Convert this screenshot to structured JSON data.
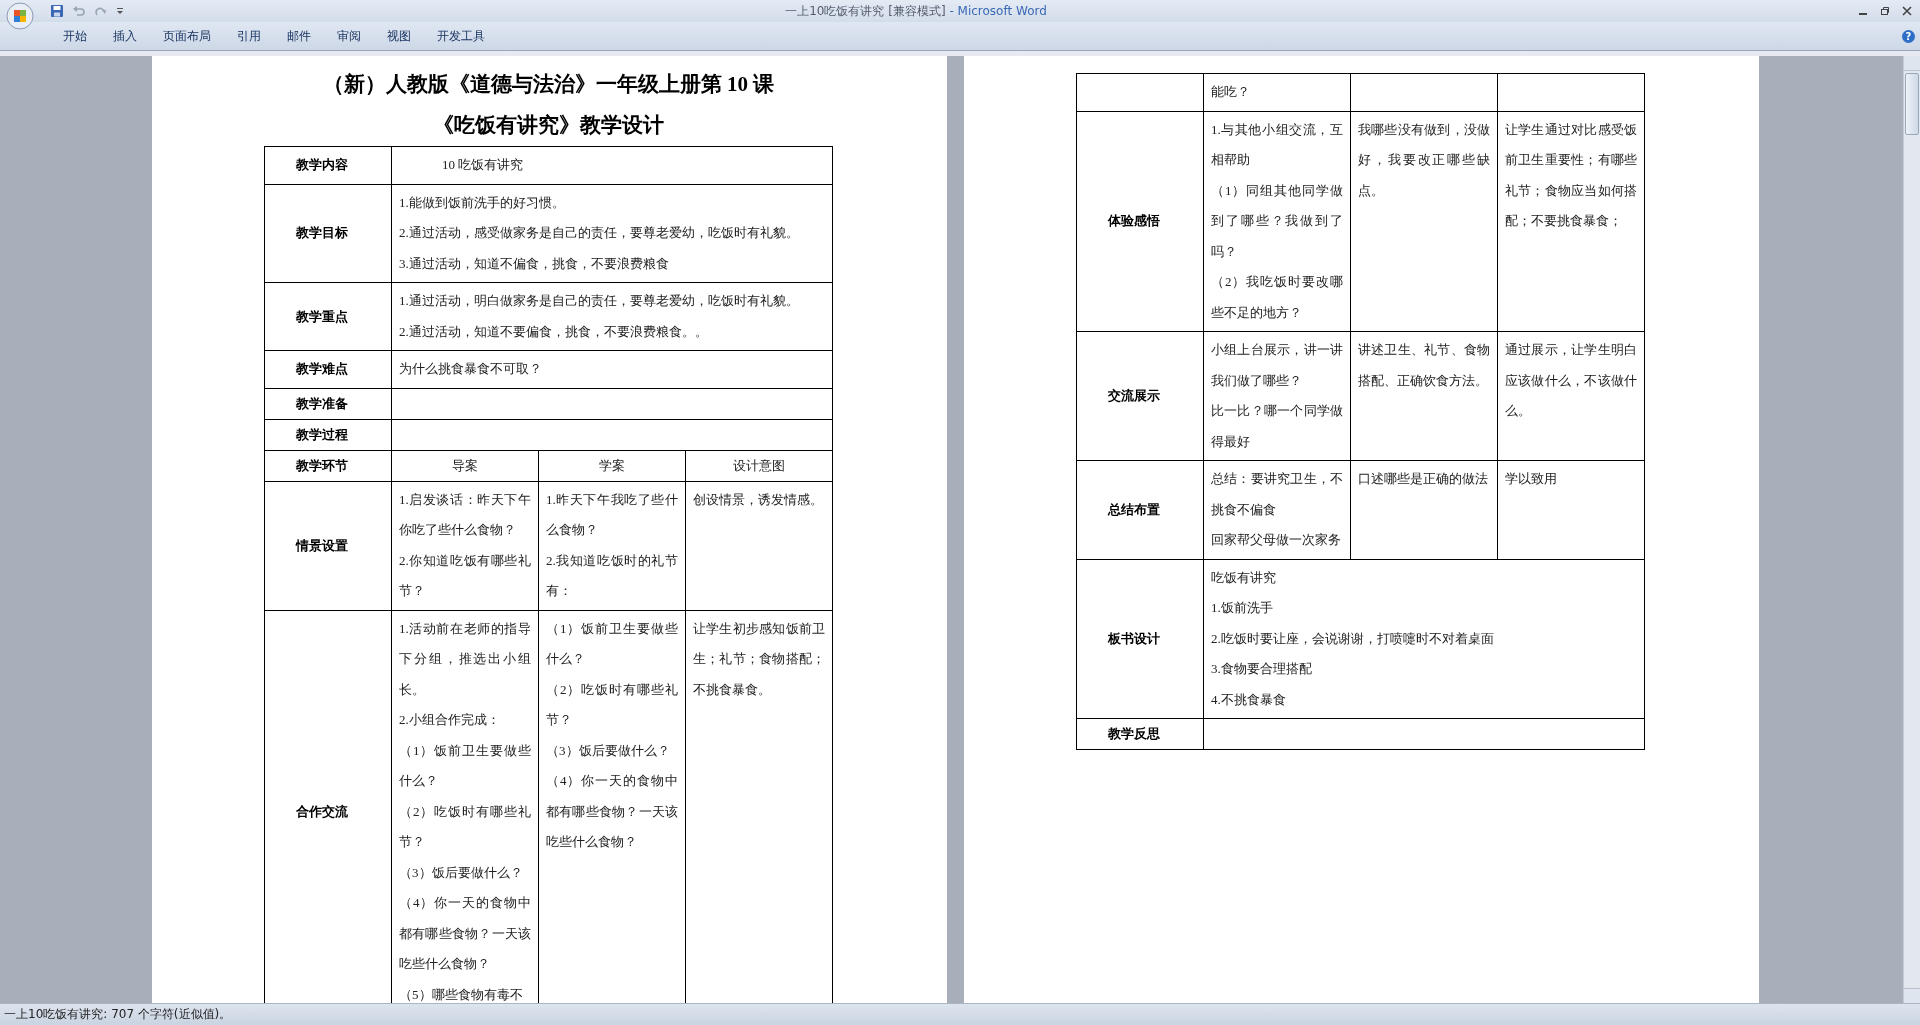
{
  "window": {
    "document_title": "一上10吃饭有讲究 [兼容模式]",
    "app_name": "- Microsoft Word"
  },
  "ribbon_tabs": [
    {
      "label": "开始"
    },
    {
      "label": "插入"
    },
    {
      "label": "页面布局"
    },
    {
      "label": "引用"
    },
    {
      "label": "邮件"
    },
    {
      "label": "审阅"
    },
    {
      "label": "视图"
    },
    {
      "label": "开发工具"
    }
  ],
  "help_button": "?",
  "pages": [
    {
      "title_lines": [
        "（新）人教版《道德与法治》一年级上册第 10 课",
        "《吃饭有讲究》教学设计"
      ],
      "rows": [
        {
          "kind": "span",
          "label": "教学内容",
          "lines": [
            "10 吃饭有讲究"
          ],
          "indent": true
        },
        {
          "kind": "span",
          "label": "教学目标",
          "lines": [
            "1.能做到饭前洗手的好习惯。",
            "2.通过活动，感受做家务是自己的责任，要尊老爱幼，吃饭时有礼貌。",
            "3.通过活动，知道不偏食，挑食，不要浪费粮食"
          ]
        },
        {
          "kind": "span",
          "label": "教学重点",
          "lines": [
            "1.通过活动，明白做家务是自己的责任，要尊老爱幼，吃饭时有礼貌。",
            "2.通过活动，知道不要偏食，挑食，不要浪费粮食。。"
          ]
        },
        {
          "kind": "span",
          "label": "教学难点",
          "lines": [
            "为什么挑食暴食不可取？"
          ]
        },
        {
          "kind": "span",
          "label": "教学准备",
          "lines": []
        },
        {
          "kind": "span",
          "label": "教学过程",
          "lines": []
        },
        {
          "kind": "header",
          "label": "教学环节",
          "headers": [
            "导案",
            "学案",
            "设计意图"
          ]
        },
        {
          "kind": "grid",
          "label": "情景设置",
          "cells": [
            [
              "1.启发谈话：昨天下午你吃了些什么食物？",
              "2.你知道吃饭有哪些礼节？"
            ],
            [
              "1.昨天下午我吃了些什么食物？",
              "2.我知道吃饭时的礼节有："
            ],
            [
              "创设情景，诱发情感。"
            ]
          ]
        },
        {
          "kind": "grid",
          "label": "合作交流",
          "cells": [
            [
              "1.活动前在老师的指导下分组，推选出小组长。",
              "2.小组合作完成：",
              "（1）饭前卫生要做些什么？",
              "（2）吃饭时有哪些礼节？",
              "（3）饭后要做什么？",
              "（4）你一天的食物中都有哪些食物？一天该吃些什么食物？",
              "（5）哪些食物有毒不"
            ],
            [
              "（1）饭前卫生要做些什么？",
              "（2）吃饭时有哪些礼节？",
              "（3）饭后要做什么？",
              "（4）你一天的食物中都有哪些食物？一天该吃些什么食物？"
            ],
            [
              "让学生初步感知饭前卫生；礼节；食物搭配；不挑食暴食。"
            ]
          ]
        }
      ]
    },
    {
      "rows": [
        {
          "kind": "grid",
          "cells": [
            [
              "能吃？"
            ],
            [],
            []
          ]
        },
        {
          "kind": "grid",
          "label": "体验感悟",
          "cells": [
            [
              "1.与其他小组交流，互相帮助",
              "（1）同组其他同学做到了哪些？我做到了吗？",
              "（2）我吃饭时要改哪些不足的地方？"
            ],
            [
              "我哪些没有做到，没做好，我要改正哪些缺点。"
            ],
            [
              "让学生通过对比感受饭前卫生重要性；有哪些礼节；食物应当如何搭配；不要挑食暴食；"
            ]
          ]
        },
        {
          "kind": "grid",
          "label": "交流展示",
          "cells": [
            [
              "小组上台展示，讲一讲我们做了哪些？",
              "比一比？哪一个同学做得最好"
            ],
            [
              "讲述卫生、礼节、食物搭配、正确饮食方法。"
            ],
            [
              "通过展示，让学生明白应该做什么，不该做什么。"
            ]
          ]
        },
        {
          "kind": "grid",
          "label": "总结布置",
          "cells": [
            [
              "总结：要讲究卫生，不挑食不偏食",
              "回家帮父母做一次家务"
            ],
            [
              "口述哪些是正确的做法"
            ],
            [
              "学以致用"
            ]
          ]
        },
        {
          "kind": "span",
          "label": "板书设计",
          "lines": [
            "吃饭有讲究",
            "1.饭前洗手",
            "2.吃饭时要让座，会说谢谢，打喷嚏时不对着桌面",
            "3.食物要合理搭配",
            "4.不挑食暴食"
          ]
        },
        {
          "kind": "span",
          "label": "教学反思",
          "lines": []
        }
      ]
    }
  ],
  "status_bar": "一上10吃饭有讲究: 707 个字符(近似值)。"
}
